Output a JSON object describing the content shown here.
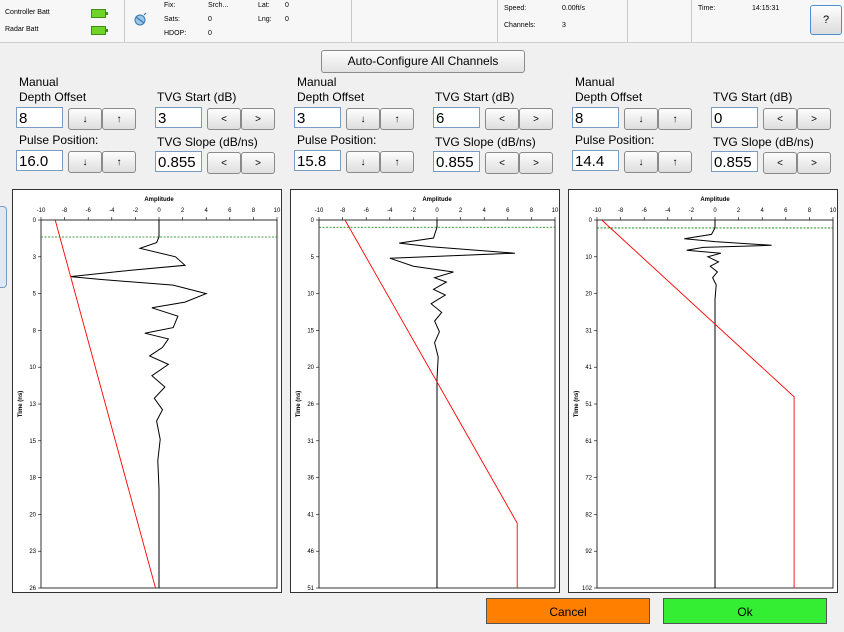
{
  "status": {
    "controller_batt": "Controller Batt",
    "radar_batt": "Radar Batt",
    "fix_label": "Fix:",
    "fix_value": "Srch...",
    "sats_label": "Sats:",
    "sats_value": "0",
    "hdop_label": "HDOP:",
    "hdop_value": "0",
    "lat_label": "Lat:",
    "lat_value": "0",
    "lng_label": "Lng:",
    "lng_value": "0",
    "speed_label": "Speed:",
    "speed_value": "0.00ft/s",
    "channels_label": "Channels:",
    "channels_value": "3",
    "time_label": "Time:",
    "time_value": "14:15:31",
    "help_label": "?"
  },
  "auto_configure_label": "Auto-Configure All Channels",
  "labels": {
    "manual": "Manual",
    "depth_offset": "Depth Offset",
    "pulse_position": "Pulse Position:",
    "tvg_start": "TVG Start (dB)",
    "tvg_slope": "TVG Slope (dB/ns)",
    "down": "↓",
    "up": "↑",
    "left": "<",
    "right": ">"
  },
  "channels": [
    {
      "depth_offset": "8",
      "pulse_position": "16.0",
      "tvg_start": "3",
      "tvg_slope": "0.855"
    },
    {
      "depth_offset": "3",
      "pulse_position": "15.8",
      "tvg_start": "6",
      "tvg_slope": "0.855"
    },
    {
      "depth_offset": "8",
      "pulse_position": "14.4",
      "tvg_start": "0",
      "tvg_slope": "0.855"
    }
  ],
  "colors": {
    "tvg_line": "#ff0000",
    "waveform": "#000000",
    "threshold": "#008000",
    "cancel": "#ff7f00",
    "ok": "#33ee33"
  },
  "buttons": {
    "cancel": "Cancel",
    "ok": "Ok"
  },
  "chart_data": [
    {
      "type": "line",
      "xlabel": "Amplitude",
      "ylabel": "Time (ns)",
      "xlim": [
        -10,
        10
      ],
      "ylim": [
        0,
        26
      ],
      "x_ticks": [
        "-10",
        "-8",
        "-6",
        "-4",
        "-2",
        "0",
        "2",
        "4",
        "6",
        "8",
        "10"
      ],
      "y_ticks": [
        "0",
        "3",
        "5",
        "8",
        "10",
        "13",
        "15",
        "18",
        "20",
        "23",
        "26"
      ],
      "threshold_y": 1.2,
      "series": [
        {
          "role": "waveform",
          "points": [
            [
              0,
              0
            ],
            [
              0,
              1.2
            ],
            [
              -0.2,
              1.6
            ],
            [
              -1.6,
              2.0
            ],
            [
              1.4,
              2.6
            ],
            [
              2.2,
              3.2
            ],
            [
              -3,
              3.6
            ],
            [
              -7.5,
              4.0
            ],
            [
              -5,
              4.2
            ],
            [
              1.2,
              4.6
            ],
            [
              4,
              5.2
            ],
            [
              2.2,
              5.8
            ],
            [
              -0.6,
              6.2
            ],
            [
              1.6,
              6.8
            ],
            [
              1.2,
              7.6
            ],
            [
              -1.2,
              8.0
            ],
            [
              0.8,
              8.4
            ],
            [
              0.3,
              9.0
            ],
            [
              -0.8,
              9.6
            ],
            [
              0.8,
              10.2
            ],
            [
              -0.6,
              11.0
            ],
            [
              0.5,
              11.8
            ],
            [
              -0.4,
              12.6
            ],
            [
              0.3,
              13.4
            ],
            [
              -0.2,
              14.2
            ],
            [
              0.1,
              15.5
            ],
            [
              -0.1,
              17
            ],
            [
              0,
              19
            ],
            [
              0,
              22
            ],
            [
              0,
              26
            ]
          ]
        },
        {
          "role": "tvg",
          "points": [
            [
              -8.8,
              0
            ],
            [
              -0.3,
              26
            ]
          ]
        }
      ]
    },
    {
      "type": "line",
      "xlabel": "Amplitude",
      "ylabel": "Time (ns)",
      "xlim": [
        -10,
        10
      ],
      "ylim": [
        0,
        51
      ],
      "x_ticks": [
        "-10",
        "-8",
        "-6",
        "-4",
        "-2",
        "0",
        "2",
        "4",
        "6",
        "8",
        "10"
      ],
      "y_ticks": [
        "0",
        "5",
        "10",
        "15",
        "20",
        "26",
        "31",
        "36",
        "41",
        "46",
        "51"
      ],
      "threshold_y": 1.0,
      "series": [
        {
          "role": "waveform",
          "points": [
            [
              0,
              0
            ],
            [
              0,
              1.0
            ],
            [
              -0.3,
              2.5
            ],
            [
              -3.2,
              3.2
            ],
            [
              -0.5,
              3.7
            ],
            [
              6.6,
              4.6
            ],
            [
              -4,
              5.3
            ],
            [
              -2,
              6.4
            ],
            [
              1.4,
              7.2
            ],
            [
              -0.2,
              8.0
            ],
            [
              0.8,
              8.6
            ],
            [
              -0.3,
              9.6
            ],
            [
              0.7,
              10.4
            ],
            [
              -0.5,
              11.6
            ],
            [
              0.4,
              12.8
            ],
            [
              -0.2,
              14.0
            ],
            [
              0.2,
              15.5
            ],
            [
              -0.2,
              17
            ],
            [
              0.1,
              19
            ],
            [
              0,
              22
            ],
            [
              0,
              30
            ],
            [
              0,
              40
            ],
            [
              0,
              51
            ]
          ]
        },
        {
          "role": "tvg",
          "points": [
            [
              -7.8,
              0
            ],
            [
              6.8,
              42
            ],
            [
              6.8,
              51
            ]
          ]
        }
      ]
    },
    {
      "type": "line",
      "xlabel": "Amplitude",
      "ylabel": "Time (ns)",
      "xlim": [
        -10,
        10
      ],
      "ylim": [
        0,
        102
      ],
      "x_ticks": [
        "-10",
        "-8",
        "-6",
        "-4",
        "-2",
        "0",
        "2",
        "4",
        "6",
        "8",
        "10"
      ],
      "y_ticks": [
        "0",
        "10",
        "20",
        "31",
        "41",
        "51",
        "61",
        "72",
        "82",
        "92",
        "102"
      ],
      "threshold_y": 2.2,
      "series": [
        {
          "role": "waveform",
          "points": [
            [
              0,
              0
            ],
            [
              0,
              2.2
            ],
            [
              -0.3,
              4.0
            ],
            [
              -2.6,
              5.2
            ],
            [
              0,
              6.0
            ],
            [
              4.8,
              7.0
            ],
            [
              -1,
              7.6
            ],
            [
              -2.4,
              8.4
            ],
            [
              0.5,
              9.2
            ],
            [
              -0.6,
              10.2
            ],
            [
              0.3,
              11.6
            ],
            [
              -0.4,
              12.8
            ],
            [
              0.2,
              14.4
            ],
            [
              -0.2,
              16
            ],
            [
              0.1,
              18
            ],
            [
              0,
              22
            ],
            [
              0,
              40
            ],
            [
              0,
              60
            ],
            [
              0,
              80
            ],
            [
              0,
              102
            ]
          ]
        },
        {
          "role": "tvg",
          "points": [
            [
              -9.6,
              0
            ],
            [
              6.7,
              49
            ],
            [
              6.7,
              102
            ]
          ]
        }
      ]
    }
  ]
}
